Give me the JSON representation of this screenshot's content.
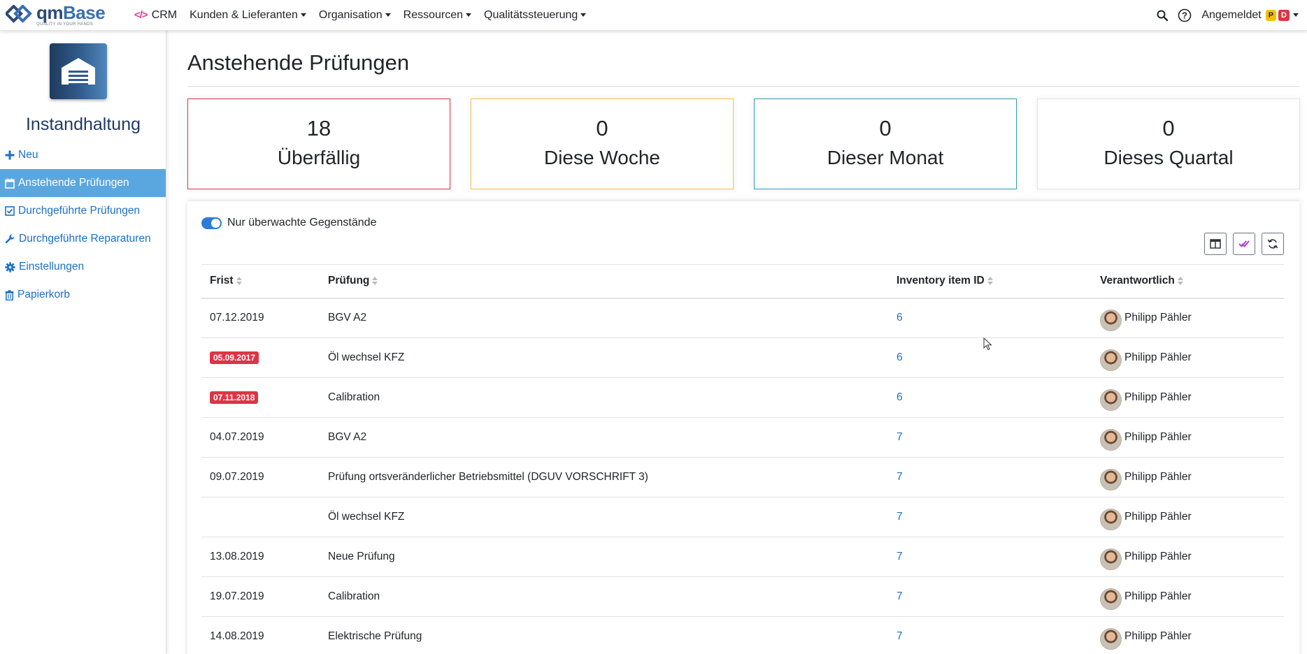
{
  "app": {
    "logo_name": "qm",
    "logo_name_b": "Base",
    "logo_tagline": "QUALITY IN YOUR HANDS"
  },
  "topnav": {
    "items": [
      {
        "label": "CRM"
      },
      {
        "label": "Kunden & Lieferanten"
      },
      {
        "label": "Organisation"
      },
      {
        "label": "Ressourcen"
      },
      {
        "label": "Qualitätssteuerung"
      }
    ],
    "login_label": "Angemeldet",
    "badge_p": "P",
    "badge_d": "D"
  },
  "sidebar": {
    "module_title": "Instandhaltung",
    "items": [
      {
        "label": "Neu",
        "icon": "plus-icon"
      },
      {
        "label": "Anstehende Prüfungen",
        "icon": "calendar-icon",
        "active": true
      },
      {
        "label": "Durchgeführte Prüfungen",
        "icon": "check-square-icon"
      },
      {
        "label": "Durchgeführte Reparaturen",
        "icon": "wrench-icon"
      },
      {
        "label": "Einstellungen",
        "icon": "gear-icon"
      },
      {
        "label": "Papierkorb",
        "icon": "trash-icon"
      }
    ]
  },
  "main": {
    "title": "Anstehende Prüfungen",
    "stats": [
      {
        "value": "18",
        "label": "Überfällig",
        "color": "#dc3545"
      },
      {
        "value": "0",
        "label": "Diese Woche",
        "color": "#f6c244"
      },
      {
        "value": "0",
        "label": "Dieser Monat",
        "color": "#2f9cb5"
      },
      {
        "value": "0",
        "label": "Dieses Quartal",
        "color": "#e4e4e4"
      }
    ],
    "filter_toggle_label": "Nur überwachte Gegenstände",
    "table": {
      "headers": [
        "Frist",
        "Prüfung",
        "Inventory item ID",
        "Verantwortlich"
      ],
      "rows": [
        {
          "frist": "07.12.2019",
          "overdue": false,
          "pruefung": "BGV A2",
          "id": "6",
          "person": "Philipp Pähler"
        },
        {
          "frist": "05.09.2017",
          "overdue": true,
          "pruefung": "Öl wechsel KFZ",
          "id": "6",
          "person": "Philipp Pähler"
        },
        {
          "frist": "07.11.2018",
          "overdue": true,
          "pruefung": "Calibration",
          "id": "6",
          "person": "Philipp Pähler"
        },
        {
          "frist": "04.07.2019",
          "overdue": false,
          "pruefung": "BGV A2",
          "id": "7",
          "person": "Philipp Pähler"
        },
        {
          "frist": "09.07.2019",
          "overdue": false,
          "pruefung": "Prüfung ortsveränderlicher Betriebsmittel (DGUV VORSCHRIFT 3)",
          "id": "7",
          "person": "Philipp Pähler"
        },
        {
          "frist": "",
          "overdue": false,
          "pruefung": "Öl wechsel KFZ",
          "id": "7",
          "person": "Philipp Pähler"
        },
        {
          "frist": "13.08.2019",
          "overdue": false,
          "pruefung": "Neue Prüfung",
          "id": "7",
          "person": "Philipp Pähler"
        },
        {
          "frist": "19.07.2019",
          "overdue": false,
          "pruefung": "Calibration",
          "id": "7",
          "person": "Philipp Pähler"
        },
        {
          "frist": "14.08.2019",
          "overdue": false,
          "pruefung": "Elektrische Prüfung",
          "id": "7",
          "person": "Philipp Pähler"
        }
      ]
    }
  }
}
